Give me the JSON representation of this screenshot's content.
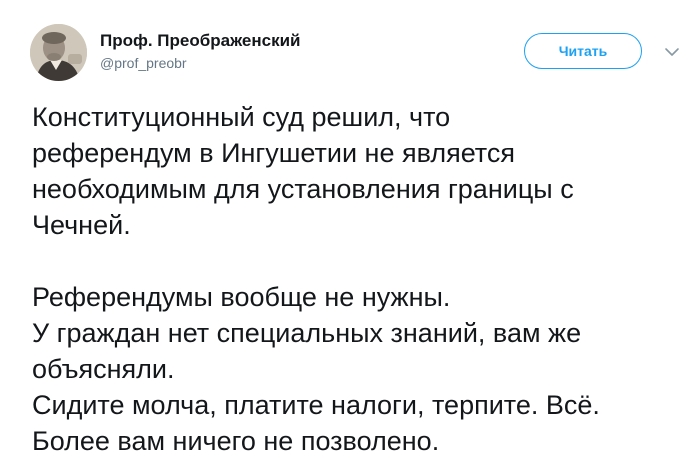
{
  "author": {
    "display_name": "Проф. Преображенский",
    "handle": "@prof_preobr",
    "avatar_icon": "avatar-photo"
  },
  "actions": {
    "follow_label": "Читать",
    "more_icon": "chevron-down-icon"
  },
  "tweet": {
    "paragraph_1": [
      "Конституционный суд решил, что",
      "референдум в Ингушетии не является",
      "необходимым для установления границы с",
      "Чечней."
    ],
    "paragraph_2": [
      "Референдумы вообще не нужны.",
      "У граждан нет специальных знаний, вам же",
      "объясняли.",
      "Сидите молча, платите налоги, терпите. Всё.",
      "Более вам ничего не позволено."
    ]
  },
  "colors": {
    "accent": "#1da1f2",
    "text": "#14171a",
    "secondary_text": "#657786"
  }
}
